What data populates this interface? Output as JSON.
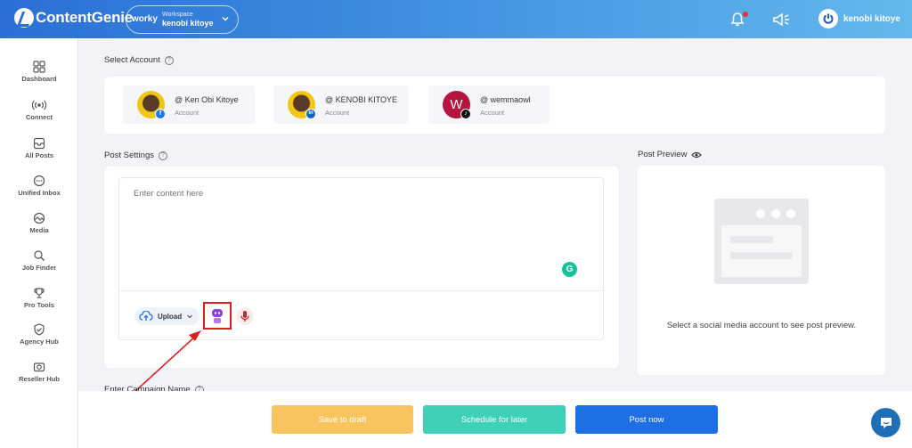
{
  "header": {
    "brand": "ContentGenie",
    "workspace_logo": "worky",
    "workspace_label": "Workspace",
    "workspace_name": "kenobi kitoye",
    "user_name": "kenobi kitoye"
  },
  "sidebar": {
    "items": [
      {
        "label": "Dashboard",
        "icon": "grid-icon"
      },
      {
        "label": "Connect",
        "icon": "broadcast-icon"
      },
      {
        "label": "All Posts",
        "icon": "inbox-icon"
      },
      {
        "label": "Unified Inbox",
        "icon": "chat-icon"
      },
      {
        "label": "Media",
        "icon": "media-icon"
      },
      {
        "label": "Job Finder",
        "icon": "search-icon"
      },
      {
        "label": "Pro Tools",
        "icon": "trophy-icon"
      },
      {
        "label": "Agency Hub",
        "icon": "shield-icon"
      },
      {
        "label": "Reseller Hub",
        "icon": "camera-icon"
      }
    ]
  },
  "select_account": {
    "title": "Select Account",
    "accounts": [
      {
        "name": "@ Ken Obi Kitoye",
        "sub": "Account",
        "network": "facebook",
        "badge": "f"
      },
      {
        "name": "@ KENOBI KITOYE",
        "sub": "Account",
        "network": "linkedin",
        "badge": "in"
      },
      {
        "name": "@ wemmaowl",
        "sub": "Account",
        "network": "tiktok",
        "badge": "♪",
        "initial": "W"
      }
    ]
  },
  "post_settings": {
    "title": "Post Settings",
    "placeholder": "Enter content here",
    "grammarly": "G",
    "upload_label": "Upload"
  },
  "post_preview": {
    "title": "Post Preview",
    "message": "Select a social media account to see post preview."
  },
  "campaign": {
    "label": "Enter Campaign Name"
  },
  "footer": {
    "draft_label": "Save to draft",
    "schedule_label": "Schedule for later",
    "post_label": "Post now"
  },
  "colors": {
    "draft": "#f9c45e",
    "schedule": "#3ed1b8",
    "post": "#1e6fe3",
    "highlight": "#e01e1e"
  }
}
